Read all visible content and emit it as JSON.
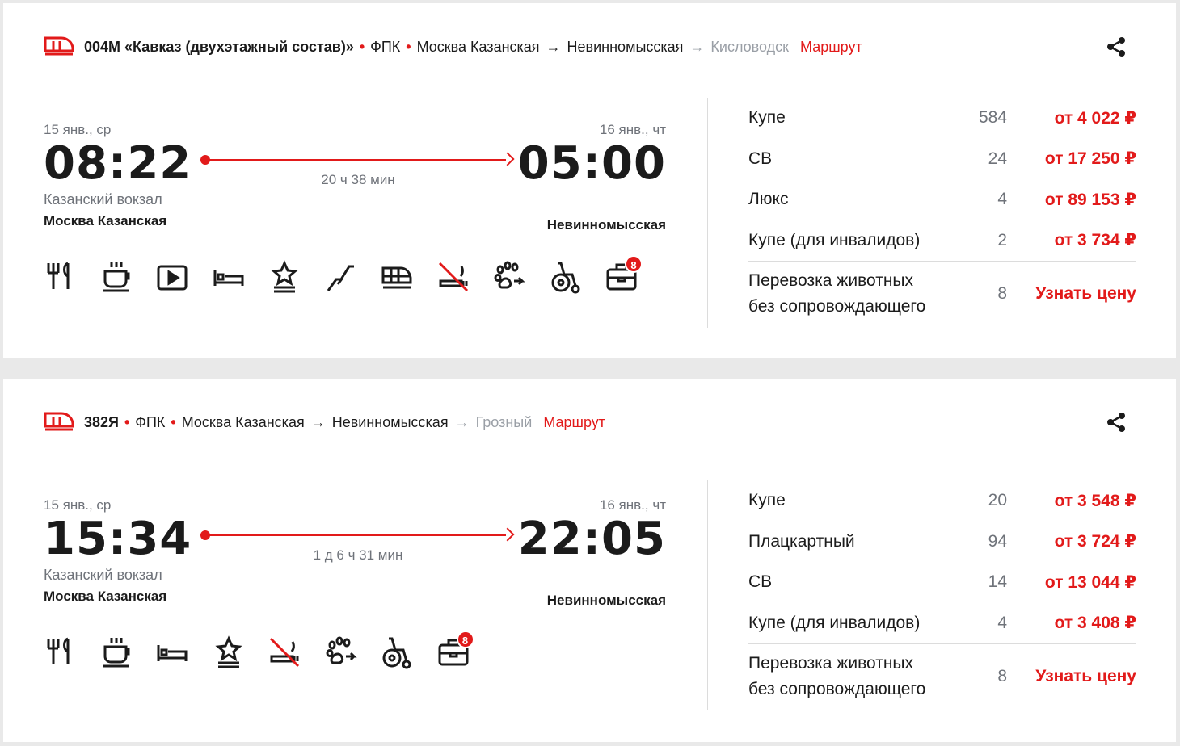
{
  "colors": {
    "accent": "#e21a1a",
    "muted": "#6f737a",
    "gray_station": "#9a9fa6"
  },
  "trains": [
    {
      "number": "004М «Кавказ (двухэтажный состав)»",
      "carrier": "ФПК",
      "from": "Москва Казанская",
      "to": "Невинномысская",
      "final": "Кисловодск",
      "route_link": "Маршрут",
      "dep_date": "15 янв., ср",
      "dep_time": "08:22",
      "dep_vokzal": "Казанский вокзал",
      "dep_station": "Москва Казанская",
      "arr_date": "16 янв., чт",
      "arr_time": "05:00",
      "arr_station": "Невинномысская",
      "duration": "20 ч 38 мин",
      "amenities": [
        "restaurant-icon",
        "coffee-icon",
        "video-icon",
        "bed-icon",
        "premium-icon",
        "stairs-icon",
        "double-decker-icon",
        "no-smoking-icon",
        "pets-icon",
        "wheelchair-icon",
        "luggage-icon"
      ],
      "luggage_badge": "8",
      "classes": [
        {
          "name": "Купе",
          "seats": "584",
          "price": "от 4 022 ₽"
        },
        {
          "name": "СВ",
          "seats": "24",
          "price": "от 17 250 ₽"
        },
        {
          "name": "Люкс",
          "seats": "4",
          "price": "от 89 153 ₽"
        },
        {
          "name": "Купе (для инвалидов)",
          "seats": "2",
          "price": "от 3 734 ₽"
        }
      ],
      "pets": {
        "line1": "Перевозка животных",
        "line2": "без сопровождающего",
        "seats": "8",
        "price": "Узнать цену"
      }
    },
    {
      "number": "382Я",
      "carrier": "ФПК",
      "from": "Москва Казанская",
      "to": "Невинномысская",
      "final": "Грозный",
      "route_link": "Маршрут",
      "dep_date": "15 янв., ср",
      "dep_time": "15:34",
      "dep_vokzal": "Казанский вокзал",
      "dep_station": "Москва Казанская",
      "arr_date": "16 янв., чт",
      "arr_time": "22:05",
      "arr_station": "Невинномысская",
      "duration": "1 д 6 ч 31 мин",
      "amenities": [
        "restaurant-icon",
        "coffee-icon",
        "bed-icon",
        "premium-icon",
        "no-smoking-icon",
        "pets-icon",
        "wheelchair-icon",
        "luggage-icon"
      ],
      "luggage_badge": "8",
      "classes": [
        {
          "name": "Купе",
          "seats": "20",
          "price": "от 3 548 ₽"
        },
        {
          "name": "Плацкартный",
          "seats": "94",
          "price": "от 3 724 ₽"
        },
        {
          "name": "СВ",
          "seats": "14",
          "price": "от 13 044 ₽"
        },
        {
          "name": "Купе (для инвалидов)",
          "seats": "4",
          "price": "от 3 408 ₽"
        }
      ],
      "pets": {
        "line1": "Перевозка животных",
        "line2": "без сопровождающего",
        "seats": "8",
        "price": "Узнать цену"
      }
    }
  ]
}
